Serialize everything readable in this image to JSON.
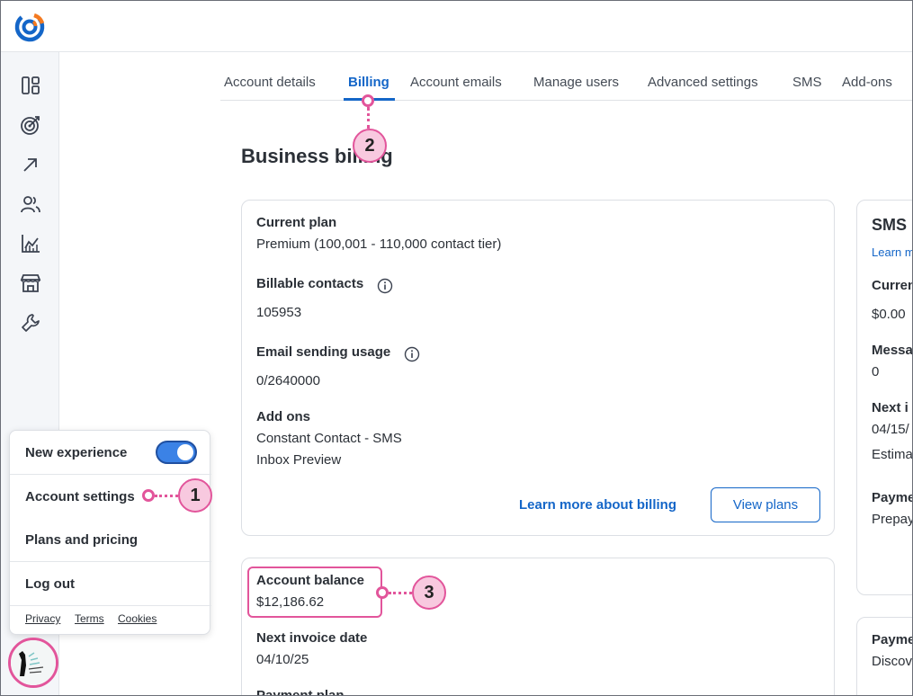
{
  "tabs": [
    "Account details",
    "Billing",
    "Account emails",
    "Manage users",
    "Advanced settings",
    "SMS",
    "Add-ons"
  ],
  "page_title": "Business billing",
  "plan_card": {
    "current_plan_label": "Current plan",
    "current_plan_value": "Premium (100,001 - 110,000 contact tier)",
    "billable_label": "Billable contacts",
    "billable_value": "105953",
    "usage_label": "Email sending usage",
    "usage_value": "0/2640000",
    "addons_label": "Add ons",
    "addons": [
      "Constant Contact - SMS",
      "Inbox Preview"
    ],
    "learn_link": "Learn more about billing",
    "view_plans": "View plans"
  },
  "balance_card": {
    "balance_label": "Account balance",
    "balance_value": "$12,186.62",
    "invoice_label": "Next invoice date",
    "invoice_value": "04/10/25",
    "payment_plan_label": "Payment plan"
  },
  "sms_card": {
    "title": "SMS",
    "learn": "Learn m",
    "current_label": "Curren",
    "current_value": "$0.00",
    "messages_label": "Messa",
    "messages_value": "0",
    "next_label": "Next i",
    "next_value": "04/15/",
    "estimate": "Estima",
    "payment_label": "Payme",
    "payment_value": "Prepay"
  },
  "payment_card": {
    "label": "Payme",
    "value": "Discov"
  },
  "menu": {
    "new_experience": "New experience",
    "new_experience_on": true,
    "account_settings": "Account settings",
    "plans_pricing": "Plans and pricing",
    "logout": "Log out",
    "footer": [
      "Privacy",
      "Terms",
      "Cookies"
    ]
  },
  "callouts": [
    "1",
    "2",
    "3"
  ],
  "colors": {
    "accent": "#1466c8",
    "callout": "#e2559b",
    "callout_fill": "#f8c9df"
  },
  "icons": [
    "dashboard-icon",
    "campaigns-target-icon",
    "arrow-up-right-icon",
    "contacts-icon",
    "reporting-chart-icon",
    "store-icon",
    "wrench-icon"
  ]
}
